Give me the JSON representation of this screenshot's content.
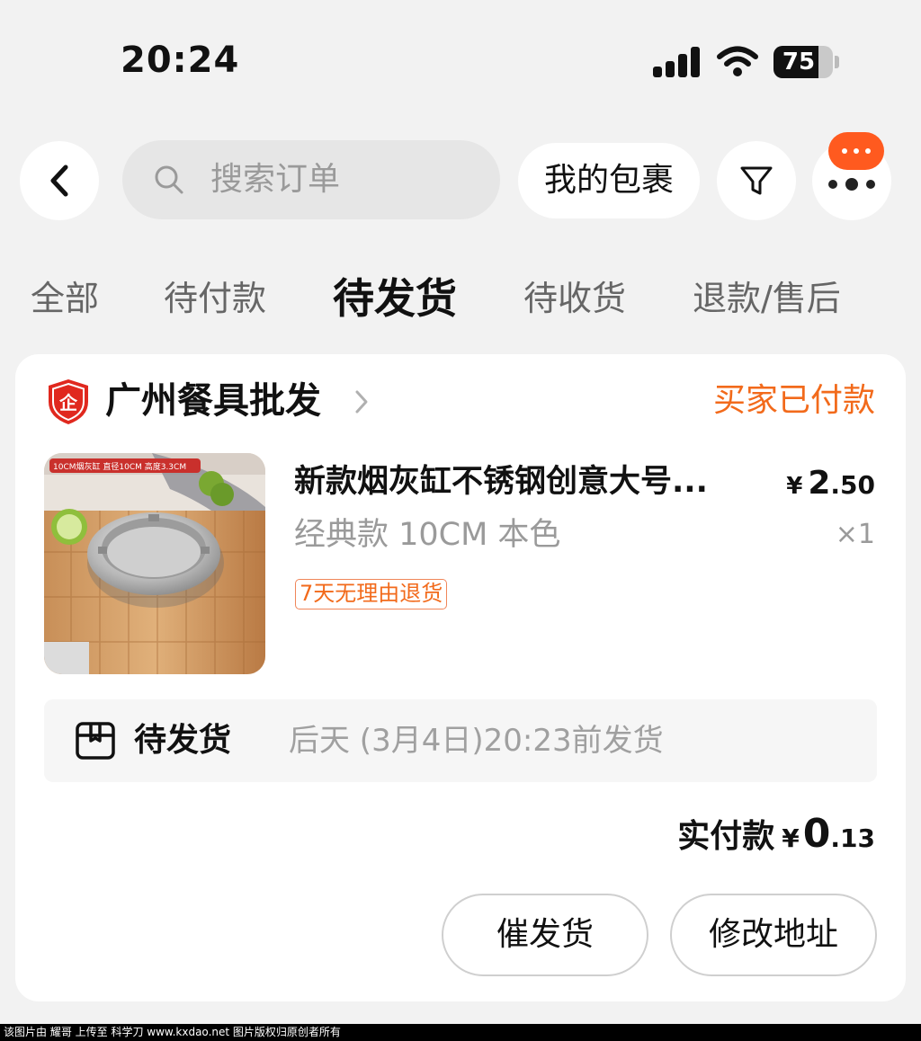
{
  "status_bar": {
    "time": "20:24",
    "battery_level": "75"
  },
  "nav": {
    "search_placeholder": "搜索订单",
    "packages_label": "我的包裹",
    "badge_color": "#ff5a1f"
  },
  "tabs": [
    {
      "label": "全部"
    },
    {
      "label": "待付款"
    },
    {
      "label": "待发货",
      "active": true
    },
    {
      "label": "待收货"
    },
    {
      "label": "退款/售后"
    }
  ],
  "order": {
    "shop_name": "广州餐具批发",
    "shop_badge_glyph": "企",
    "status": "买家已付款",
    "product": {
      "image_caption": "10CM烟灰缸 直径10CM 高度3.3CM",
      "title": "新款烟灰缸不锈钢创意大号...",
      "price_symbol": "¥",
      "price_int": "2",
      "price_dec": ".50",
      "spec": "经典款 10CM 本色",
      "quantity": "×1",
      "tag": "7天无理由退货"
    },
    "shipping": {
      "label": "待发货",
      "deadline": "后天 (3月4日)20:23前发货"
    },
    "payment": {
      "label": "实付款",
      "symbol": "¥",
      "int": "0",
      "dec": ".13"
    },
    "actions": {
      "urge_label": "催发货",
      "address_label": "修改地址"
    },
    "accent_color": "#f26a1b"
  },
  "watermark": "该图片由 耀哥 上传至 科学刀 www.kxdao.net 图片版权归原创者所有"
}
